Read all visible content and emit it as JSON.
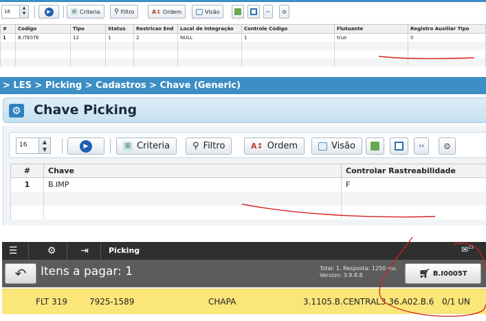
{
  "panel_top": {
    "page_size": "16",
    "buttons": {
      "criteria": "Criteria",
      "filtro": "Filtro",
      "ordem": "Ordem",
      "visao": "Visão"
    },
    "columns": [
      "#",
      "Codigo",
      "Tipo",
      "Status",
      "Restricao End",
      "Local de Integração",
      "Controle Código",
      "Flutuante",
      "Registro Auxiliar Tipo"
    ],
    "rows": [
      [
        "1",
        "B.ITESTE",
        "12",
        "1",
        "2",
        "NULL",
        "1",
        "true",
        "0"
      ]
    ]
  },
  "breadcrumb": "> LES > Picking > Cadastros > Chave (Generic)",
  "panel_mid": {
    "title": "Chave Picking",
    "page_size": "16",
    "buttons": {
      "criteria": "Criteria",
      "filtro": "Filtro",
      "ordem": "Ordem",
      "visao": "Visão"
    },
    "columns": [
      "#",
      "Chave",
      "Controlar Rastreabilidade"
    ],
    "rows": [
      [
        "1",
        "B.IMP",
        "F"
      ]
    ]
  },
  "mobile": {
    "app_label": "Picking",
    "notification_count": "13",
    "items_title": "Itens a pagar: 1",
    "info_line1": "Total: 1. Resposta: 1250 ms.",
    "info_line2": "Version: 3.9.8.8",
    "code_button": "B.I0005T",
    "item": {
      "code": "FLT 319",
      "ref": "7925-1589",
      "desc": "CHAPA",
      "location": "3.1105.B.CENTRAL3.36.A02.B.6",
      "qty": "0/1 UN"
    }
  },
  "colors": {
    "accent_blue": "#3d8ec4",
    "annotation_red": "#d42020",
    "item_yellow": "#fbe67a"
  }
}
